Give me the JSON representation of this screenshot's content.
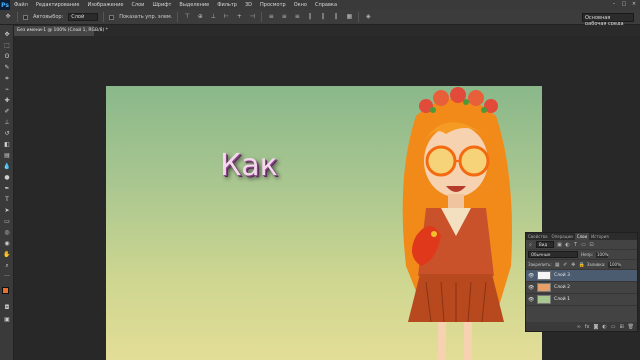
{
  "menubar": {
    "logo": "Ps",
    "items": [
      "Файл",
      "Редактирование",
      "Изображение",
      "Слои",
      "Шрифт",
      "Выделение",
      "Фильтр",
      "3D",
      "Просмотр",
      "Окно",
      "Справка"
    ],
    "window_controls": [
      "–",
      "□",
      "×"
    ]
  },
  "options": {
    "autoselect_label": "Автовыбор:",
    "autoselect_value": "Слой",
    "transform_label": "Показать упр. элем.",
    "workspace": "Основная рабочая среда"
  },
  "document_tab": "Без имени-1 @ 100% (Слой 1, RGB/8) *",
  "canvas": {
    "text": "Как"
  },
  "panel": {
    "tabs": [
      "Свойства",
      "Операции",
      "Слои",
      "История"
    ],
    "active_tab": "Слои",
    "filter_label": "Вид",
    "blend_mode": "Обычные",
    "opacity_label": "Непр:",
    "opacity_value": "100%",
    "lock_label": "Закрепить:",
    "fill_label": "Заливка:",
    "fill_value": "100%",
    "layers": [
      {
        "name": "Слой 3",
        "selected": true,
        "thumb": "#f6f6f6"
      },
      {
        "name": "Слой 2",
        "selected": false,
        "thumb": "#e8a06a"
      },
      {
        "name": "Слой 1",
        "selected": false,
        "thumb": "#a8c890"
      }
    ]
  },
  "colors": {
    "accent": "#4ab0ff",
    "foreground": "#e8702a",
    "background": "#ffffff"
  }
}
